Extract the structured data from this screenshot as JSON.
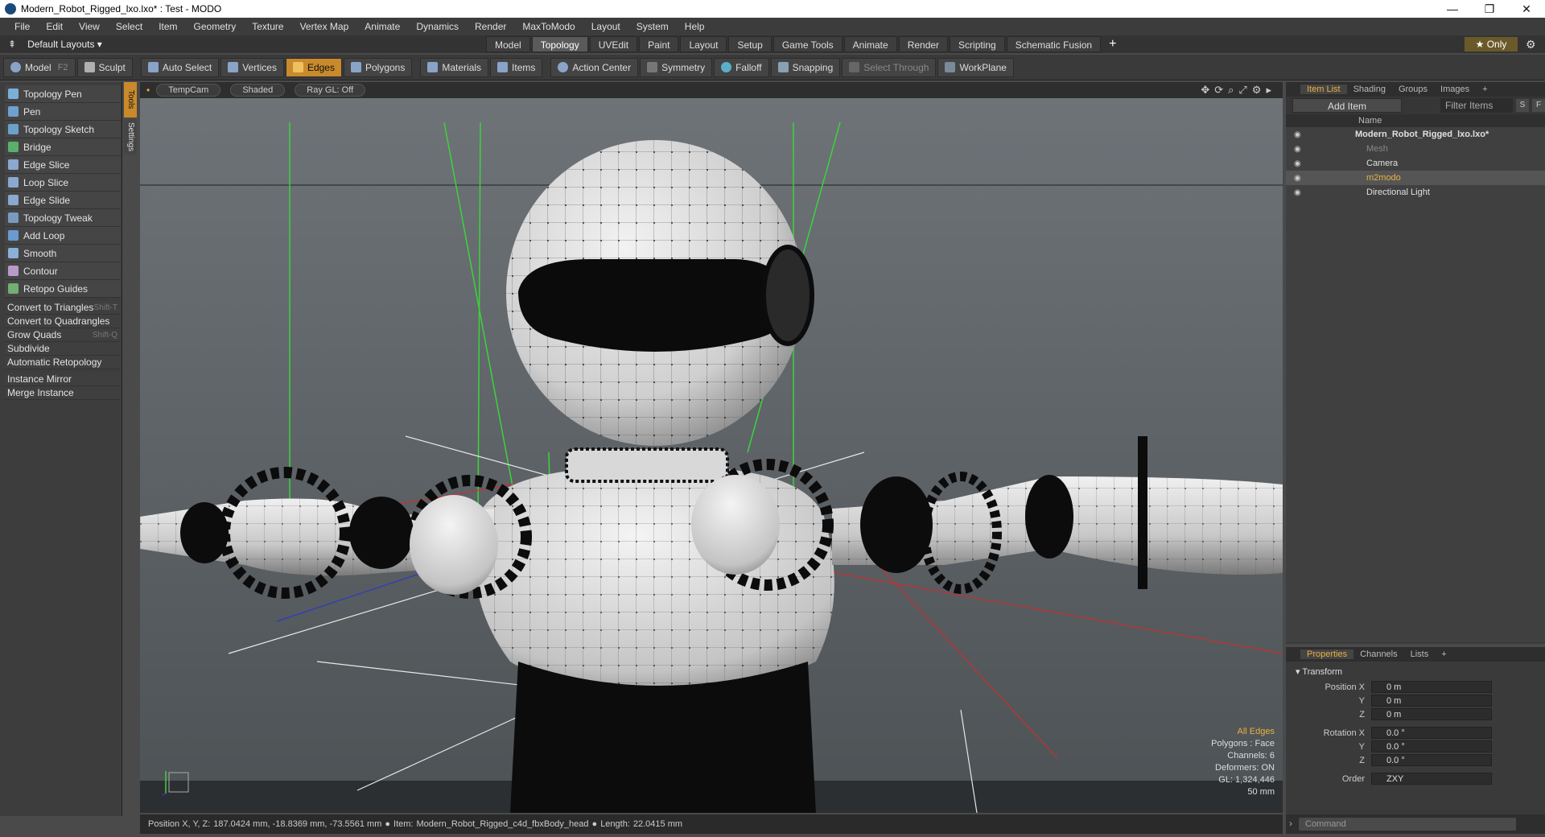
{
  "window": {
    "title": "Modern_Robot_Rigged_lxo.lxo* : Test - MODO",
    "controls": [
      "—",
      "❐",
      "✕"
    ]
  },
  "menu": [
    "File",
    "Edit",
    "View",
    "Select",
    "Item",
    "Geometry",
    "Texture",
    "Vertex Map",
    "Animate",
    "Dynamics",
    "Render",
    "MaxToModo",
    "Layout",
    "System",
    "Help"
  ],
  "layout_bar": {
    "layouts_label": "Default Layouts ▾",
    "tabs": [
      "Model",
      "Topology",
      "UVEdit",
      "Paint",
      "Layout",
      "Setup",
      "Game Tools",
      "Animate",
      "Render",
      "Scripting",
      "Schematic Fusion"
    ],
    "active_tab": "Topology",
    "add_tab": "+",
    "only_label": "★ Only"
  },
  "toolbar": {
    "model": "Model",
    "model_key": "F2",
    "sculpt": "Sculpt",
    "auto_select": "Auto Select",
    "vertices": "Vertices",
    "edges": "Edges",
    "polygons": "Polygons",
    "materials": "Materials",
    "items": "Items",
    "action_center": "Action Center",
    "symmetry": "Symmetry",
    "falloff": "Falloff",
    "snapping": "Snapping",
    "select_through": "Select Through",
    "workplane": "WorkPlane"
  },
  "side_tabs": [
    "Tools",
    "Settings"
  ],
  "tools": [
    {
      "label": "Topology Pen",
      "color": "#7ab0d8"
    },
    {
      "label": "Pen",
      "color": "#6fa0d0"
    },
    {
      "label": "Topology Sketch",
      "color": "#6ca0c8"
    },
    {
      "label": "Bridge",
      "color": "#5ab06a"
    },
    {
      "label": "Edge Slice",
      "color": "#8aa8d0"
    },
    {
      "label": "Loop Slice",
      "color": "#8aa8d0"
    },
    {
      "label": "Edge Slide",
      "color": "#8aa8d0"
    },
    {
      "label": "Topology Tweak",
      "color": "#7a9ac0"
    },
    {
      "label": "Add Loop",
      "color": "#6a9ad0"
    },
    {
      "label": "Smooth",
      "color": "#8ab0d8"
    },
    {
      "label": "Contour",
      "color": "#b89ac8"
    },
    {
      "label": "Retopo Guides",
      "color": "#70b070"
    }
  ],
  "commands": [
    {
      "label": "Convert to Triangles",
      "shortcut": "Shift-T"
    },
    {
      "label": "Convert to Quadrangles",
      "shortcut": ""
    },
    {
      "label": "Grow Quads",
      "shortcut": "Shift-Q"
    },
    {
      "label": "Subdivide",
      "shortcut": ""
    },
    {
      "label": "Automatic Retopology",
      "shortcut": ""
    }
  ],
  "commands2": [
    "Instance Mirror",
    "Merge Instance"
  ],
  "viewport": {
    "camera": "TempCam",
    "shading": "Shaded",
    "raygl": "Ray GL: Off",
    "info": {
      "selection": "All Edges",
      "polygons": "Polygons : Face",
      "channels": "Channels: 6",
      "deformers": "Deformers: ON",
      "gl": "GL: 1,324,446",
      "focal": "50 mm"
    }
  },
  "statusbar": {
    "position_label": "Position X, Y, Z:",
    "position_value": "187.0424 mm, -18.8369 mm, -73.5561 mm",
    "item_label": "Item:",
    "item_value": "Modern_Robot_Rigged_c4d_fbxBody_head",
    "length_label": "Length:",
    "length_value": "22.0415 mm"
  },
  "item_list": {
    "tabs": [
      "Item List",
      "Shading",
      "Groups",
      "Images",
      "+"
    ],
    "add_item": "Add Item",
    "filter": "Filter Items",
    "s_btn": "S",
    "f_btn": "F",
    "column_name": "Name",
    "items": [
      {
        "label": "Modern_Robot_Rigged_lxo.lxo*",
        "indent": 0,
        "bold": true
      },
      {
        "label": "Mesh",
        "indent": 1,
        "dim": true
      },
      {
        "label": "Camera",
        "indent": 1
      },
      {
        "label": "m2modo",
        "indent": 1,
        "highlight": true
      },
      {
        "label": "Directional Light",
        "indent": 1
      }
    ]
  },
  "properties": {
    "tabs": [
      "Properties",
      "Channels",
      "Lists",
      "+"
    ],
    "section": "Transform",
    "rows": [
      {
        "label": "Position X",
        "value": "0 m"
      },
      {
        "label": "Y",
        "value": "0 m"
      },
      {
        "label": "Z",
        "value": "0 m"
      },
      {
        "label": "Rotation X",
        "value": "0.0 °"
      },
      {
        "label": "Y",
        "value": "0.0 °"
      },
      {
        "label": "Z",
        "value": "0.0 °"
      },
      {
        "label": "Order",
        "value": "ZXY"
      }
    ]
  },
  "command_field": "Command",
  "colors": {
    "accent": "#c98a2c",
    "highlight_text": "#e8b040"
  }
}
